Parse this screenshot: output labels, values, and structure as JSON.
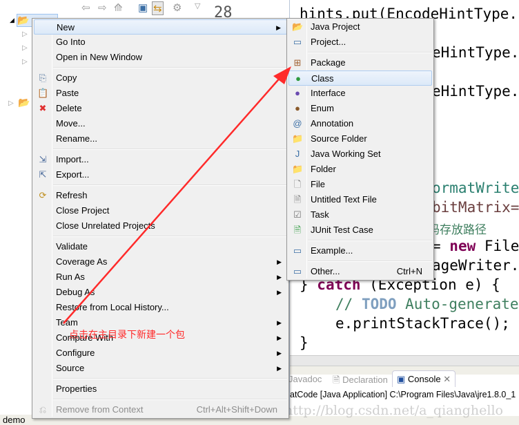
{
  "explorer": {
    "project_name": "demo",
    "status": "demo"
  },
  "editor": {
    "line_numbers": [
      "28"
    ],
    "lines": {
      "l1": "hints.put(EncodeHintType.",
      "l2": "eHintType.",
      "l3": "eHintType.",
      "l4": "ormatWrite",
      "l5": "bitMatrix=",
      "l6": "码存放路径",
      "l7a": "= ",
      "l7b": "new",
      "l7c": " File",
      "l8": "ageWriter.",
      "l9a": "} ",
      "l9b": "catch",
      "l9c": " (Exception e) {",
      "l10a": "// ",
      "l10b": "TODO",
      "l10c": " Auto-generate",
      "l11": "e.printStackTrace();",
      "l12": "}"
    }
  },
  "context_menu": {
    "items": [
      {
        "label": "New",
        "submenu": true,
        "highlighted": true
      },
      {
        "label": "Go Into"
      },
      {
        "label": "Open in New Window"
      },
      {
        "label": "Copy",
        "icon": "copy-icon"
      },
      {
        "label": "Paste",
        "icon": "paste-icon"
      },
      {
        "label": "Delete",
        "icon": "delete-icon"
      },
      {
        "label": "Move..."
      },
      {
        "label": "Rename..."
      },
      {
        "label": "Import...",
        "icon": "import-icon"
      },
      {
        "label": "Export...",
        "icon": "export-icon"
      },
      {
        "label": "Refresh",
        "icon": "refresh-icon"
      },
      {
        "label": "Close Project"
      },
      {
        "label": "Close Unrelated Projects"
      },
      {
        "label": "Validate"
      },
      {
        "label": "Coverage As",
        "submenu": true
      },
      {
        "label": "Run As",
        "submenu": true
      },
      {
        "label": "Debug As",
        "submenu": true
      },
      {
        "label": "Restore from Local History..."
      },
      {
        "label": "Team",
        "submenu": true
      },
      {
        "label": "Compare With",
        "submenu": true
      },
      {
        "label": "Configure",
        "submenu": true
      },
      {
        "label": "Source",
        "submenu": true
      },
      {
        "label": "Properties"
      },
      {
        "label": "Remove from Context",
        "shortcut": "Ctrl+Alt+Shift+Down",
        "disabled": true
      }
    ]
  },
  "new_submenu": {
    "items": [
      {
        "label": "Java Project"
      },
      {
        "label": "Project..."
      },
      {
        "label": "Package"
      },
      {
        "label": "Class",
        "highlighted": true
      },
      {
        "label": "Interface"
      },
      {
        "label": "Enum"
      },
      {
        "label": "Annotation"
      },
      {
        "label": "Source Folder"
      },
      {
        "label": "Java Working Set"
      },
      {
        "label": "Folder"
      },
      {
        "label": "File"
      },
      {
        "label": "Untitled Text File"
      },
      {
        "label": "Task"
      },
      {
        "label": "JUnit Test Case"
      },
      {
        "label": "Example..."
      },
      {
        "label": "Other...",
        "shortcut": "Ctrl+N"
      }
    ]
  },
  "bottom_panel": {
    "tabs": [
      "Javadoc",
      "Declaration",
      "Console"
    ],
    "active_tab": "Console",
    "console_line": "atCode [Java Application] C:\\Program Files\\Java\\jre1.8.0_1"
  },
  "annotation": {
    "text": "点击在主目录下新建一个包",
    "color": "#ff2a2a"
  },
  "watermark": "http://blog.csdn.net/a_qianghello"
}
